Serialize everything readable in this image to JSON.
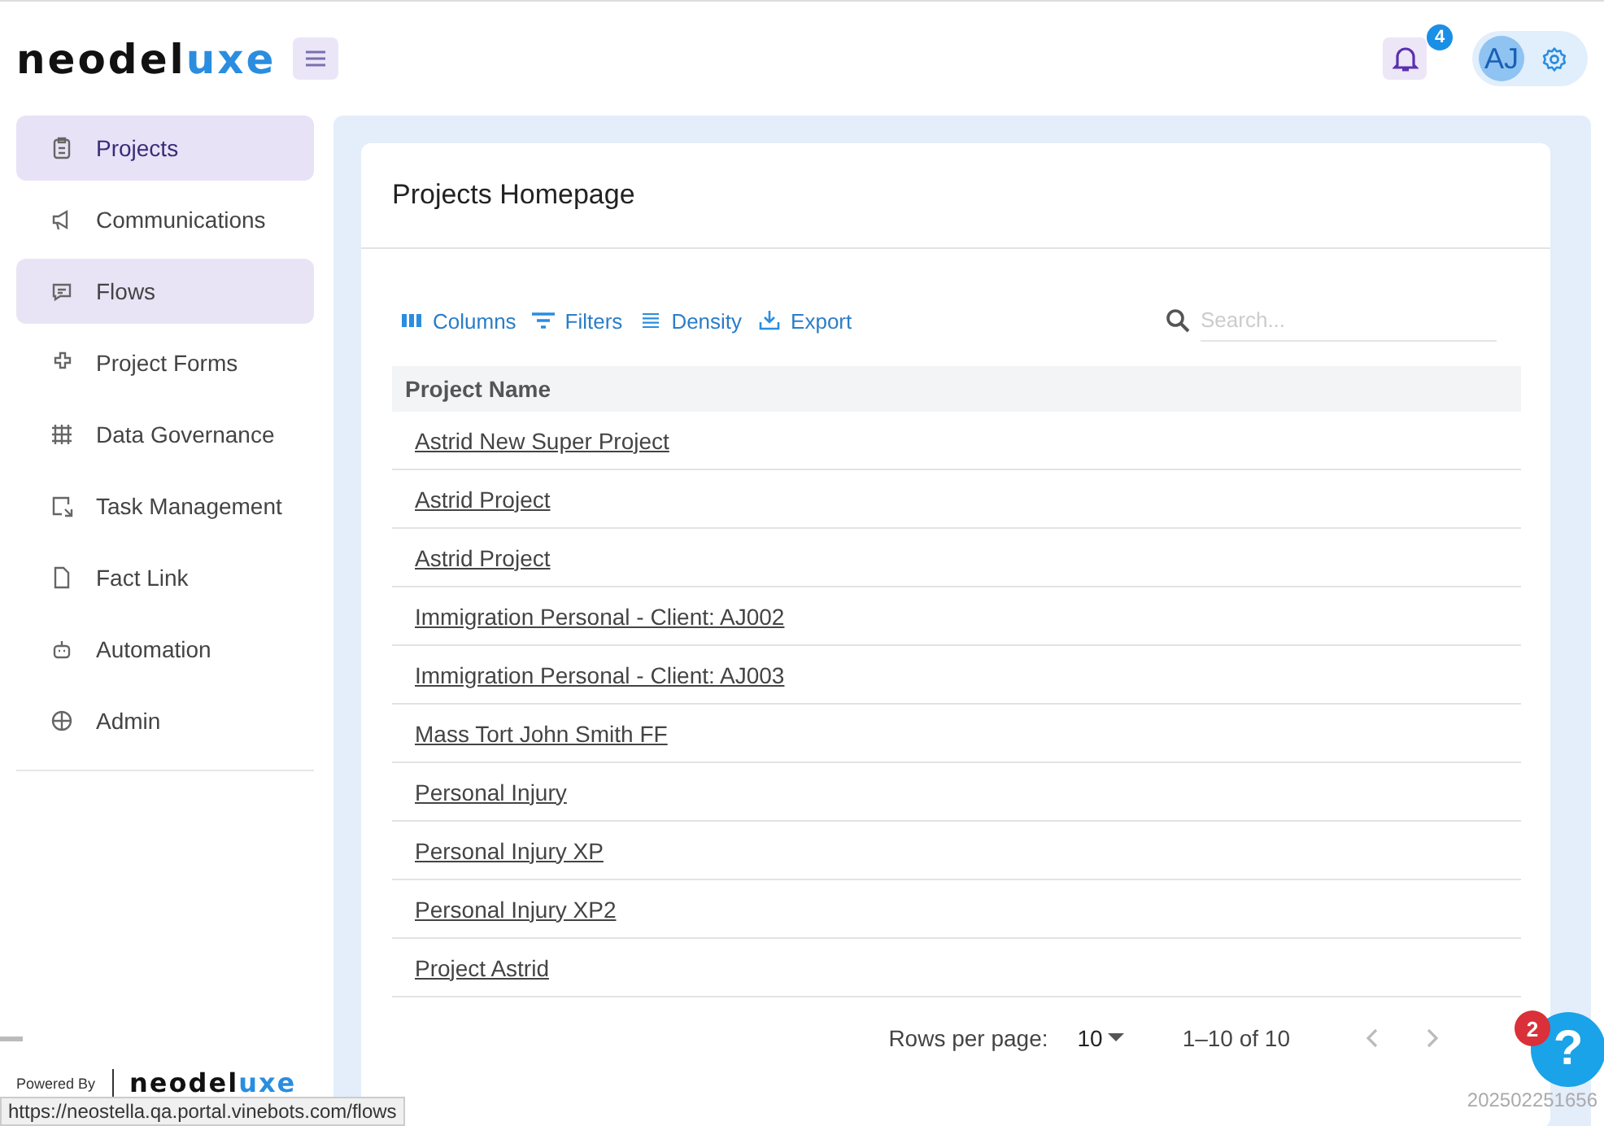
{
  "header": {
    "logo": {
      "dark": "neodel",
      "accent": "uxe"
    },
    "notifications": {
      "count": "4"
    },
    "avatar": {
      "initials": "AJ"
    }
  },
  "sidebar": {
    "items": [
      {
        "label": "Projects",
        "selected": true,
        "hovered": false
      },
      {
        "label": "Communications",
        "selected": false,
        "hovered": false
      },
      {
        "label": "Flows",
        "selected": false,
        "hovered": true
      },
      {
        "label": "Project Forms",
        "selected": false,
        "hovered": false
      },
      {
        "label": "Data Governance",
        "selected": false,
        "hovered": false
      },
      {
        "label": "Task Management",
        "selected": false,
        "hovered": false
      },
      {
        "label": "Fact Link",
        "selected": false,
        "hovered": false
      },
      {
        "label": "Automation",
        "selected": false,
        "hovered": false
      },
      {
        "label": "Admin",
        "selected": false,
        "hovered": false
      }
    ],
    "powered_by": "Powered By",
    "footer_logo": {
      "dark": "neodel",
      "accent": "uxe"
    }
  },
  "status_url": "https://neostella.qa.portal.vinebots.com/flows",
  "card": {
    "title": "Projects Homepage",
    "toolbar": [
      "Columns",
      "Filters",
      "Density",
      "Export"
    ],
    "search": {
      "placeholder": "Search..."
    },
    "table": {
      "columns": [
        "Project Name"
      ],
      "rows": [
        "Astrid New Super Project",
        "Astrid Project",
        "Astrid Project",
        "Immigration Personal - Client: AJ002",
        "Immigration Personal - Client: AJ003",
        "Mass Tort John Smith FF",
        "Personal Injury",
        "Personal Injury XP",
        "Personal Injury XP2",
        "Project Astrid"
      ]
    },
    "pagination": {
      "rows_per_page_label": "Rows per page:",
      "rows_per_page": "10",
      "range": "1–10 of 10"
    }
  },
  "help": {
    "badge": "2",
    "label": "?"
  },
  "version": "202502251656"
}
